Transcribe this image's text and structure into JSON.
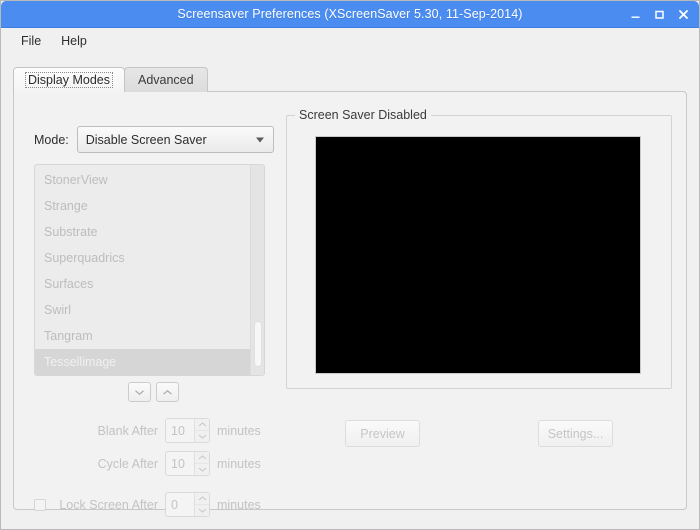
{
  "window": {
    "title": "Screensaver Preferences  (XScreenSaver 5.30, 11-Sep-2014)",
    "controls": {
      "minimize": "minimize-icon",
      "maximize": "maximize-icon",
      "close": "close-icon"
    },
    "titlebar_color": "#4a8cf0"
  },
  "menubar": {
    "items": [
      {
        "label": "File"
      },
      {
        "label": "Help"
      }
    ]
  },
  "tabs": [
    {
      "label": "Display Modes",
      "active": true
    },
    {
      "label": "Advanced",
      "active": false
    }
  ],
  "mode": {
    "label": "Mode:",
    "value": "Disable Screen Saver",
    "arrow_icon": "chevron-down-icon"
  },
  "saver_list": {
    "items": [
      {
        "label": "StonerView",
        "selected": false
      },
      {
        "label": "Strange",
        "selected": false
      },
      {
        "label": "Substrate",
        "selected": false
      },
      {
        "label": "Superquadrics",
        "selected": false
      },
      {
        "label": "Surfaces",
        "selected": false
      },
      {
        "label": "Swirl",
        "selected": false
      },
      {
        "label": "Tangram",
        "selected": false
      },
      {
        "label": "Tessellimage",
        "selected": true
      }
    ]
  },
  "reorder": {
    "down_icon": "chevron-down-icon",
    "up_icon": "chevron-up-icon"
  },
  "timers": {
    "rows": [
      {
        "label": "Blank After",
        "value": "10",
        "unit": "minutes"
      },
      {
        "label": "Cycle After",
        "value": "10",
        "unit": "minutes"
      }
    ],
    "lock": {
      "label": "Lock Screen After",
      "value": "0",
      "unit": "minutes",
      "checked": false
    }
  },
  "preview": {
    "legend": "Screen Saver Disabled",
    "screen_color": "#000000"
  },
  "actions": [
    {
      "label": "Preview",
      "enabled": false
    },
    {
      "label": "Settings...",
      "enabled": false
    }
  ]
}
